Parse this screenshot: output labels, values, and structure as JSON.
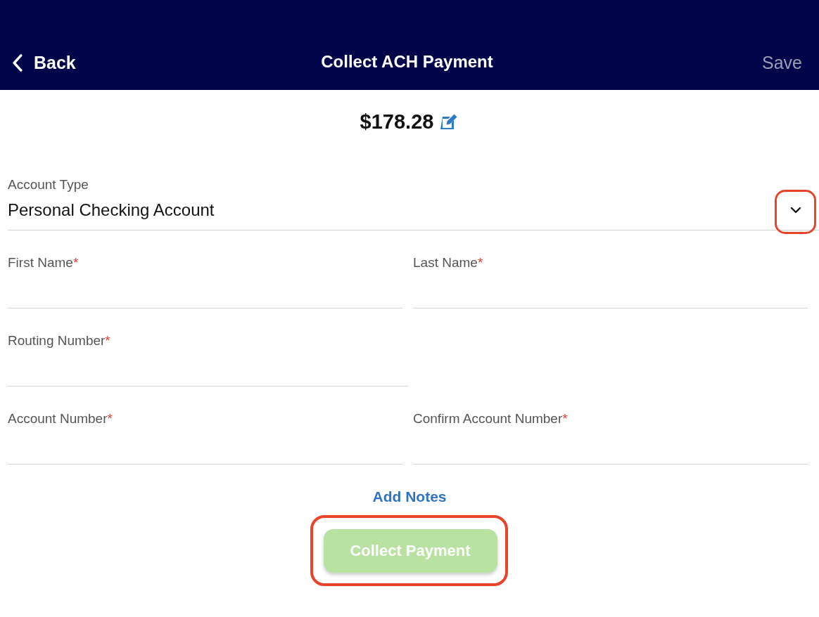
{
  "header": {
    "back": {
      "label": "Back"
    },
    "title": "Collect ACH Payment",
    "save": {
      "label": "Save",
      "disabled": true
    }
  },
  "amount": {
    "value": "$178.28"
  },
  "account_type": {
    "label": "Account Type",
    "value": "Personal Checking Account",
    "highlighted": true
  },
  "form_rows": [
    {
      "fields": [
        {
          "label": "First Name",
          "required_mark": "*"
        },
        {
          "label": "Last Name",
          "required_mark": "*"
        }
      ]
    },
    {
      "fields": [
        {
          "label": "Routing Number",
          "required_mark": "*"
        }
      ]
    },
    {
      "fields": [
        {
          "label": "Account Number",
          "required_mark": "*"
        },
        {
          "label": "Confirm Account Number",
          "required_mark": "*"
        }
      ]
    }
  ],
  "add_notes": {
    "label": "Add Notes"
  },
  "submit": {
    "label": "Collect Payment",
    "disabled": true,
    "highlighted": true
  }
}
